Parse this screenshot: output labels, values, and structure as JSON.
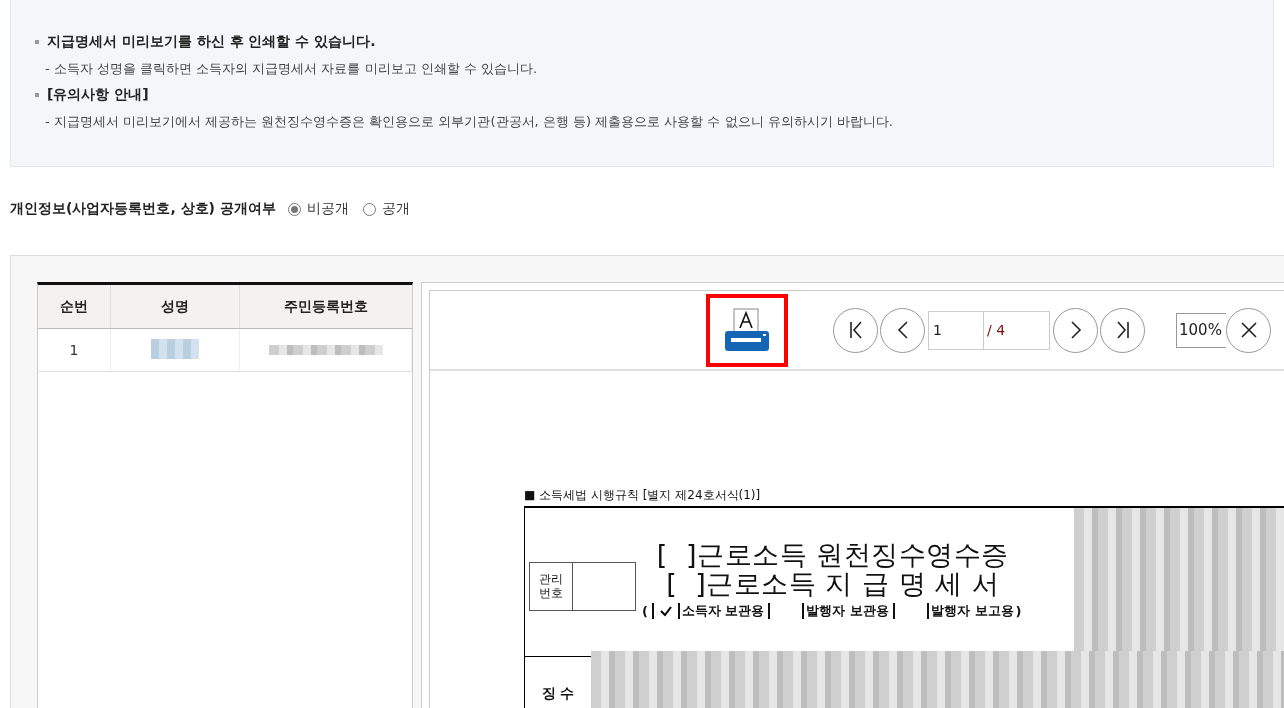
{
  "notice": {
    "items": [
      {
        "title": "지급명세서 미리보기를 하신 후 인쇄할 수 있습니다.",
        "detail": "- 소득자 성명을 클릭하면 소득자의 지급명세서 자료를 미리보고 인쇄할 수 있습니다."
      },
      {
        "title": "[유의사항 안내]",
        "detail": "- 지급명세서 미리보기에서 제공하는 원천징수영수증은 확인용으로 외부기관(관공서, 은행 등) 제출용으로 사용할 수 없으니 유의하시기 바랍니다."
      }
    ]
  },
  "privacy": {
    "label": "개인정보(사업자등록번호, 상호) 공개여부",
    "options": [
      {
        "label": "비공개",
        "selected": true
      },
      {
        "label": "공개",
        "selected": false
      }
    ]
  },
  "table": {
    "columns": [
      "순번",
      "성명",
      "주민등록번호"
    ],
    "rows": [
      {
        "no": "1"
      }
    ]
  },
  "viewer": {
    "page": "1",
    "total": "/ 4",
    "zoom": "100%",
    "document": {
      "header": "■ 소득세법 시행규칙 [별지 제24호서식(1)]",
      "mgmt_label": "관리\n번호",
      "title_1": "[  ]근로소득 원천징수영수증",
      "title_2": "[  ]근로소득 지 급 명 세 서",
      "copies_open": "(",
      "copies_close": ")",
      "copies": [
        {
          "label": "소득자 보관용",
          "checked": true
        },
        {
          "label": "발행자 보관용",
          "checked": false
        },
        {
          "label": "발행자 보고용",
          "checked": false
        }
      ],
      "section": "징 수"
    }
  }
}
